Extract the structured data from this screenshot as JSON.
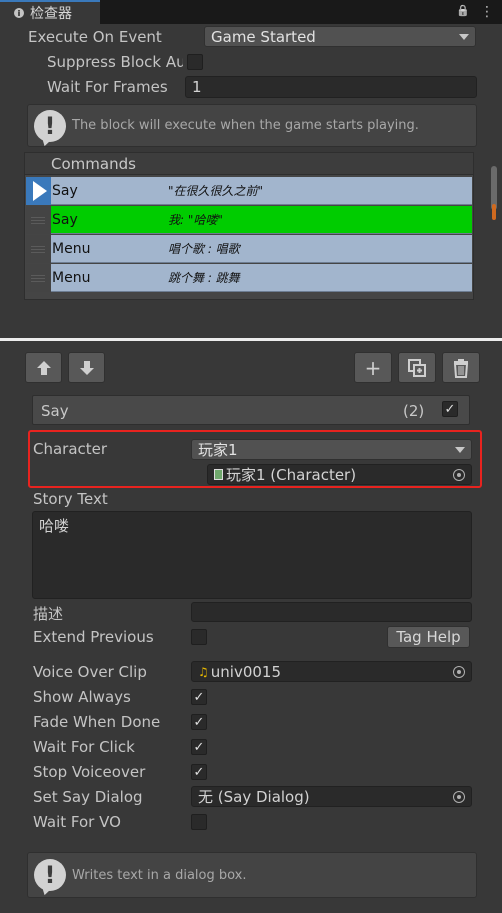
{
  "window": {
    "tab_title": "检查器",
    "lock_glyph": "🔒",
    "menu_glyph": "⋮",
    "tab_icon_glyph": "i"
  },
  "block": {
    "execute_label": "Execute On Event",
    "execute_value": "Game Started",
    "suppress_label": "Suppress Block Au",
    "suppress_checked": false,
    "wait_frames_label": "Wait For Frames",
    "wait_frames_value": "1",
    "help_text": "The block will execute when the game starts playing."
  },
  "commands": {
    "header": "Commands",
    "rows": [
      {
        "name": "Say",
        "desc": "\"在很久很久之前\"",
        "color": "#a2b5cd",
        "selected": true
      },
      {
        "name": "Say",
        "desc": "我: \"哈喽\"",
        "color": "#00cc00",
        "selected": false
      },
      {
        "name": "Menu",
        "desc": "唱个歌 : 唱歌",
        "color": "#a2b5cd",
        "selected": false
      },
      {
        "name": "Menu",
        "desc": "跳个舞 : 跳舞",
        "color": "#a2b5cd",
        "selected": false
      }
    ]
  },
  "toolbar": {
    "up_glyph": "🡡",
    "down_glyph": "🡣",
    "add_glyph": "+",
    "duplicate_glyph": "⧉",
    "delete_glyph": "🗑"
  },
  "say": {
    "title": "Say",
    "count": "(2)",
    "enabled": true,
    "character_label": "Character",
    "character_value": "玩家1",
    "character_object": "玩家1 (Character)",
    "story_text_label": "Story Text",
    "story_text_value": "哈喽",
    "description_label": "描述",
    "description_value": "",
    "extend_previous_label": "Extend Previous",
    "extend_previous_checked": false,
    "tag_help_label": "Tag Help",
    "voice_over_label": "Voice Over Clip",
    "voice_over_value": "univ0015",
    "show_always_label": "Show Always",
    "show_always_checked": true,
    "fade_when_done_label": "Fade When Done",
    "fade_when_done_checked": true,
    "wait_for_click_label": "Wait For Click",
    "wait_for_click_checked": true,
    "stop_voiceover_label": "Stop Voiceover",
    "stop_voiceover_checked": true,
    "set_say_dialog_label": "Set Say Dialog",
    "set_say_dialog_value": "无 (Say Dialog)",
    "wait_for_vo_label": "Wait For VO",
    "wait_for_vo_checked": false,
    "help_text": "Writes text in a dialog box."
  },
  "colors": {
    "highlight": "#e8231f",
    "accent": "#3a79bb",
    "row_default": "#a2b5cd",
    "row_active": "#00cc00"
  }
}
